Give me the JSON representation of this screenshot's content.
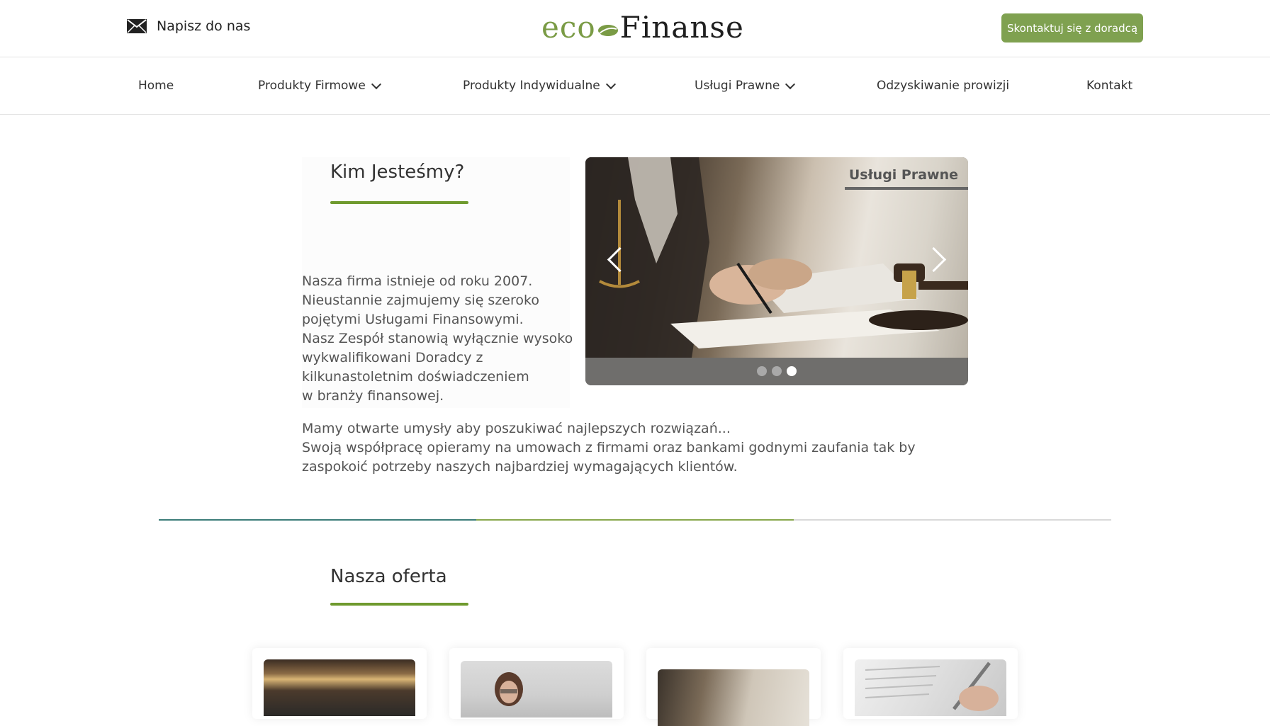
{
  "header": {
    "mail_label": "Napisz do nas",
    "logo_eco": "eco",
    "logo_finanse": "Finanse",
    "cta_label": "Skontaktuj się z doradcą"
  },
  "nav": {
    "items": [
      {
        "label": "Home",
        "dropdown": false
      },
      {
        "label": "Produkty Firmowe",
        "dropdown": true
      },
      {
        "label": "Produkty Indywidualne",
        "dropdown": true
      },
      {
        "label": "Usługi Prawne",
        "dropdown": true
      },
      {
        "label": "Odzyskiwanie prowizji",
        "dropdown": false
      },
      {
        "label": "Kontakt",
        "dropdown": false
      }
    ]
  },
  "about": {
    "title": "Kim Jesteśmy?",
    "paragraph1": [
      "Nasza firma istnieje od roku 2007.",
      "Nieustannie zajmujemy się szeroko",
      "pojętymi Usługami Finansowymi.",
      "Nasz Zespół stanowią wyłącznie wysoko",
      "wykwalifikowani Doradcy z",
      "kilkunastoletnim doświadczeniem",
      "w branży finansowej."
    ],
    "paragraph2": [
      "Mamy otwarte umysły aby poszukiwać najlepszych rozwiązań...",
      "Swoją współpracę opieramy na umowach z firmami oraz bankami godnymi zaufania  tak by",
      "zaspokoić potrzeby naszych najbardziej wymagających klientów."
    ]
  },
  "carousel": {
    "caption": "Usługi Prawne",
    "slide_count": 3,
    "active_slide": 3
  },
  "offer": {
    "title": "Nasza oferta"
  },
  "colors": {
    "accent": "#7fa150",
    "underline": "#6f9a2e",
    "divider_teal": "#3c7d79",
    "divider_green": "#88a84c"
  }
}
